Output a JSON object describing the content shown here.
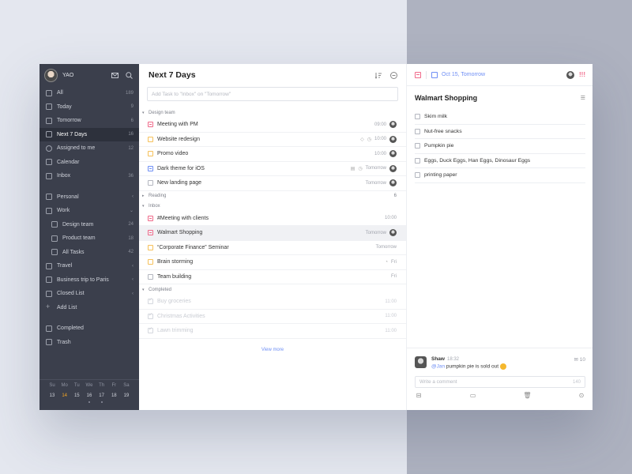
{
  "sidebar": {
    "user": "YAO",
    "items": [
      {
        "label": "All",
        "count": "189"
      },
      {
        "label": "Today",
        "count": "9"
      },
      {
        "label": "Tomorrow",
        "count": "6"
      },
      {
        "label": "Next 7 Days",
        "count": "16"
      },
      {
        "label": "Assigned to me",
        "count": "12"
      },
      {
        "label": "Calendar",
        "count": ""
      },
      {
        "label": "Inbox",
        "count": "36"
      }
    ],
    "lists": [
      {
        "label": "Personal",
        "chev": "‹"
      },
      {
        "label": "Work",
        "chev": "⌄"
      }
    ],
    "work_children": [
      {
        "label": "Design team",
        "count": "24"
      },
      {
        "label": "Product team",
        "count": "18"
      },
      {
        "label": "All Tasks",
        "count": "42"
      }
    ],
    "more_lists": [
      {
        "label": "Travel",
        "chev": "‹"
      },
      {
        "label": "Business trip to Paris",
        "chev": "‹"
      },
      {
        "label": "Closed List",
        "chev": "‹"
      },
      {
        "label": "Add List",
        "chev": ""
      }
    ],
    "bottom": [
      {
        "label": "Completed"
      },
      {
        "label": "Trash"
      }
    ],
    "calendar": {
      "days": [
        "Su",
        "Mo",
        "Tu",
        "We",
        "Th",
        "Fr",
        "Sa"
      ],
      "dates": [
        "13",
        "14",
        "15",
        "16",
        "17",
        "18",
        "19"
      ]
    }
  },
  "middle": {
    "title": "Next 7 Days",
    "add_placeholder": "Add Task to \"Inbox\" on \"Tomorrow\"",
    "sections": {
      "design": "Design team",
      "reading": "Reading",
      "reading_count": "6",
      "inbox": "Inbox",
      "completed": "Completed"
    },
    "design_tasks": [
      {
        "title": "Meeting with PM",
        "time": "09:00"
      },
      {
        "title": "Website redesign",
        "time": "10:00"
      },
      {
        "title": "Promo video",
        "time": "10:00"
      },
      {
        "title": "Dark theme for iOS",
        "time": "Tomorrow"
      },
      {
        "title": "New landing page",
        "time": "Tomorrow"
      }
    ],
    "inbox_tasks": [
      {
        "title": "#Meeting with clients",
        "time": "10:00"
      },
      {
        "title": "Walmart Shopping",
        "time": "Tomorrow"
      },
      {
        "title": "“Corporate Finance” Seminar",
        "time": "Tomorrow"
      },
      {
        "title": "Brain storming",
        "time": "Fri"
      },
      {
        "title": "Team building",
        "time": "Fri"
      }
    ],
    "completed_tasks": [
      {
        "title": "Buy groceries",
        "time": "11:00"
      },
      {
        "title": "Christmas Activities",
        "time": "11:00"
      },
      {
        "title": "Lawn trimming",
        "time": "11:00"
      }
    ],
    "view_more": "View more"
  },
  "detail": {
    "date": "Oct 15, Tomorrow",
    "title": "Walmart Shopping",
    "checklist": [
      "Skim milk",
      "Nut-free snacks",
      "Pumpkin pie",
      "Eggs, Duck Eggs, Han Eggs, Dinosaur Eggs",
      "printing paper"
    ],
    "comment": {
      "name": "Shaw",
      "time": "18:32",
      "mention": "@Jan",
      "text": " pumpkin pie is sold out",
      "count": "10"
    },
    "comment_placeholder": "Write a comment",
    "comment_limit": "140"
  },
  "colors": {
    "sidebar_bg": "#3b3f4c",
    "accent_blue": "#6f8ff5",
    "priority_red": "#f06a8a",
    "priority_yellow": "#f6c15a",
    "today_orange": "#f5a623"
  }
}
